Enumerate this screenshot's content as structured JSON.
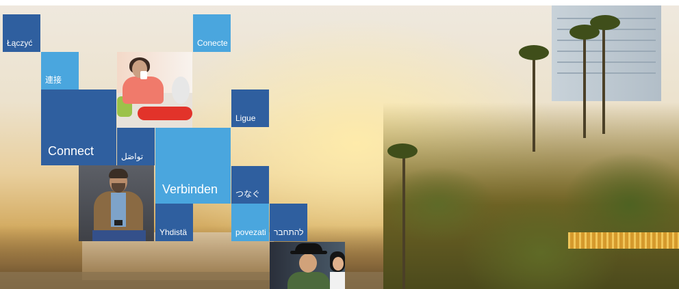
{
  "tiles": {
    "polish": "Łączyć",
    "portuguese_top": "Conecte",
    "chinese": "連接",
    "portuguese_br": "Ligue",
    "english": "Connect",
    "arabic": "تواصَل",
    "german": "Verbinden",
    "japanese": "つなぐ",
    "finnish": "Yhdistä",
    "croatian": "povezati",
    "hebrew": "להתחבר"
  },
  "photos": {
    "photo_1": "woman-with-cup",
    "photo_2": "man-with-phone",
    "photo_3": "people-laughing"
  },
  "colors": {
    "tile_dark": "#2f5f9f",
    "tile_mid": "#3a86c8",
    "tile_light": "#4aa6de"
  }
}
